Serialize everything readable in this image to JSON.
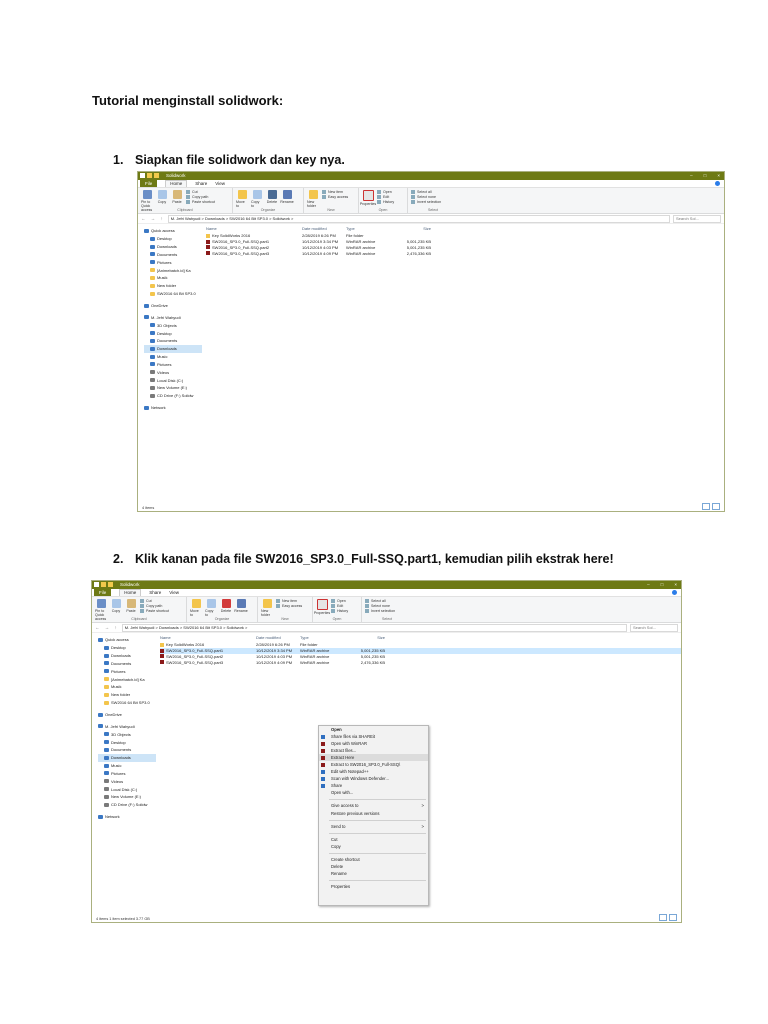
{
  "document": {
    "title": "Tutorial menginstall solidwork:",
    "step1": {
      "num": "1.",
      "text": "Siapkan file solidwork dan key nya."
    },
    "step2": {
      "num": "2.",
      "text": "Klik kanan pada file SW2016_SP3.0_Full-SSQ.part1, kemudian pilih ekstrak here!"
    }
  },
  "explorer1": {
    "title": "Solidwork",
    "tabs": [
      "File",
      "Home",
      "Share",
      "View"
    ],
    "window_controls": [
      "–",
      "□",
      "×"
    ],
    "ribbon": {
      "pin": "Pin to Quick access",
      "copy": "Copy",
      "paste": "Paste",
      "cut": "Cut",
      "copy_path": "Copy path",
      "paste_shortcut": "Paste shortcut",
      "move_to": "Move to",
      "copy_to": "Copy to",
      "delete": "Delete",
      "rename": "Rename",
      "new_folder": "New folder",
      "new_item": "New item",
      "easy_access": "Easy access",
      "properties": "Properties",
      "open": "Open",
      "edit": "Edit",
      "history": "History",
      "select_all": "Select all",
      "select_none": "Select none",
      "invert_selection": "Invert selection",
      "groups": [
        "Clipboard",
        "Organize",
        "New",
        "Open",
        "Select"
      ]
    },
    "address": "M. Jefri Wahyudi  >  Downloads  >  SW2016 64 Bit SP3.0  >  Solidwork  >",
    "search_placeholder": "Search Sol...",
    "nav": [
      "Quick access",
      "Desktop",
      "Downloads",
      "Documents",
      "Pictures",
      "[Animebatch.id] Ka",
      "Musik",
      "New folder",
      "SW2016 64 Bit SP3.0",
      "OneDrive",
      "M. Jefri Wahyudi",
      "3D Objects",
      "Desktop",
      "Documents",
      "Downloads",
      "Music",
      "Pictures",
      "Videos",
      "Local Disk (C:)",
      "New Volume (E:)",
      "CD Drive (F:) Solidw",
      "Network"
    ],
    "columns": [
      "Name",
      "Date modified",
      "Type",
      "Size"
    ],
    "files": [
      {
        "name": "Key SolidWorks 2016",
        "date": "2/28/2019 6:26 PM",
        "type": "File folder",
        "size": ""
      },
      {
        "name": "SW2016_SP3.0_Full-SSQ.part1",
        "date": "10/12/2019 3:34 PM",
        "type": "WinRAR archive",
        "size": "5,001,235 KB"
      },
      {
        "name": "SW2016_SP3.0_Full-SSQ.part2",
        "date": "10/12/2019 4:03 PM",
        "type": "WinRAR archive",
        "size": "5,001,235 KB"
      },
      {
        "name": "SW2016_SP3.0_Full-SSQ.part3",
        "date": "10/12/2019 4:09 PM",
        "type": "WinRAR archive",
        "size": "2,476,336 KB"
      }
    ],
    "status": "4 items"
  },
  "explorer2": {
    "status": "4 items   1 item selected  3.77 GB",
    "context_menu": [
      "Open",
      "Share files via SHAREit",
      "Open with WinRAR",
      "Extract files...",
      "Extract Here",
      "Extract to SW2016_SP3.0_Full-SSQ\\",
      "Edit with Notepad++",
      "Scan with Windows Defender...",
      "Share",
      "Open with...",
      "Give access to",
      "Restore previous versions",
      "Send to",
      "Cut",
      "Copy",
      "Create shortcut",
      "Delete",
      "Rename",
      "Properties"
    ]
  },
  "colors": {
    "titlebar": "#6e7a14",
    "selection": "#cce8ff",
    "archive_icon": "#8b1a1a"
  }
}
